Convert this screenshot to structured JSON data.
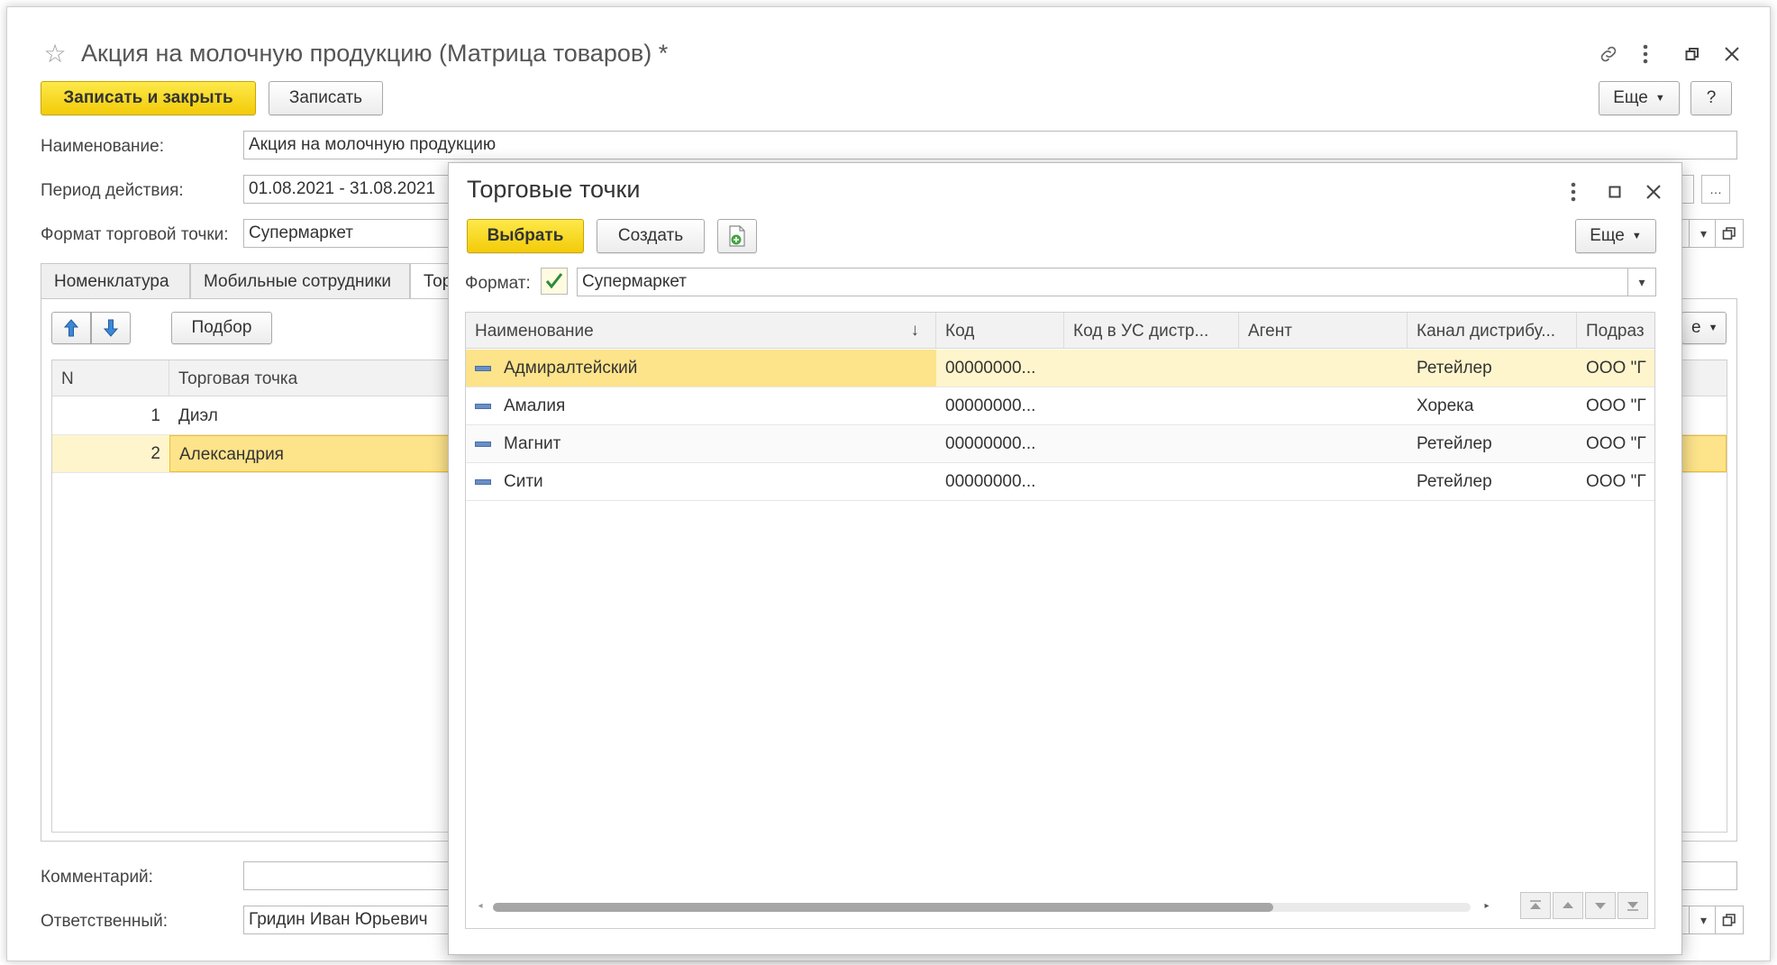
{
  "window": {
    "title": "Акция на молочную продукцию (Матрица товаров) *",
    "more_label": "Еще",
    "help_label": "?"
  },
  "toolbar": {
    "save_close_label": "Записать и закрыть",
    "save_label": "Записать"
  },
  "form": {
    "name_label": "Наименование:",
    "name_value": "Акция на молочную продукцию",
    "period_label": "Период действия:",
    "period_value": "01.08.2021 - 31.08.2021",
    "format_label": "Формат торговой точки:",
    "format_value": "Супермаркет",
    "comment_label": "Комментарий:",
    "comment_value": "",
    "responsible_label": "Ответственный:",
    "responsible_value": "Гридин Иван Юрьевич"
  },
  "tabs": [
    {
      "label": "Номенклатура"
    },
    {
      "label": "Мобильные сотрудники"
    },
    {
      "label": "Тор"
    }
  ],
  "tab_toolbar": {
    "pick_label": "Подбор",
    "more_label": "е"
  },
  "outlets_table": {
    "columns": [
      "N",
      "Торговая точка"
    ],
    "rows": [
      {
        "n": "1",
        "name": "Диэл"
      },
      {
        "n": "2",
        "name": "Александрия"
      }
    ]
  },
  "dialog": {
    "title": "Торговые точки",
    "select_label": "Выбрать",
    "create_label": "Создать",
    "more_label": "Еще",
    "format_label": "Формат:",
    "format_value": "Супермаркет",
    "columns": [
      "Наименование",
      "Код",
      "Код в УС дистр...",
      "Агент",
      "Канал дистрибу...",
      "Подраз"
    ],
    "rows": [
      {
        "name": "Адмиралтейский",
        "code": "00000000...",
        "us_code": "",
        "agent": "",
        "channel": "Ретейлер",
        "division": "ООО \"Г"
      },
      {
        "name": "Амалия",
        "code": "00000000...",
        "us_code": "",
        "agent": "",
        "channel": "Хорека",
        "division": "ООО \"Г"
      },
      {
        "name": "Магнит",
        "code": "00000000...",
        "us_code": "",
        "agent": "",
        "channel": "Ретейлер",
        "division": "ООО \"Г"
      },
      {
        "name": "Сити",
        "code": "00000000...",
        "us_code": "",
        "agent": "",
        "channel": "Ретейлер",
        "division": "ООО \"Г"
      }
    ]
  },
  "colors": {
    "accent_yellow": "#f5d01a",
    "selected_row": "#fde9a0",
    "selected_row_light": "#fff5cc"
  }
}
